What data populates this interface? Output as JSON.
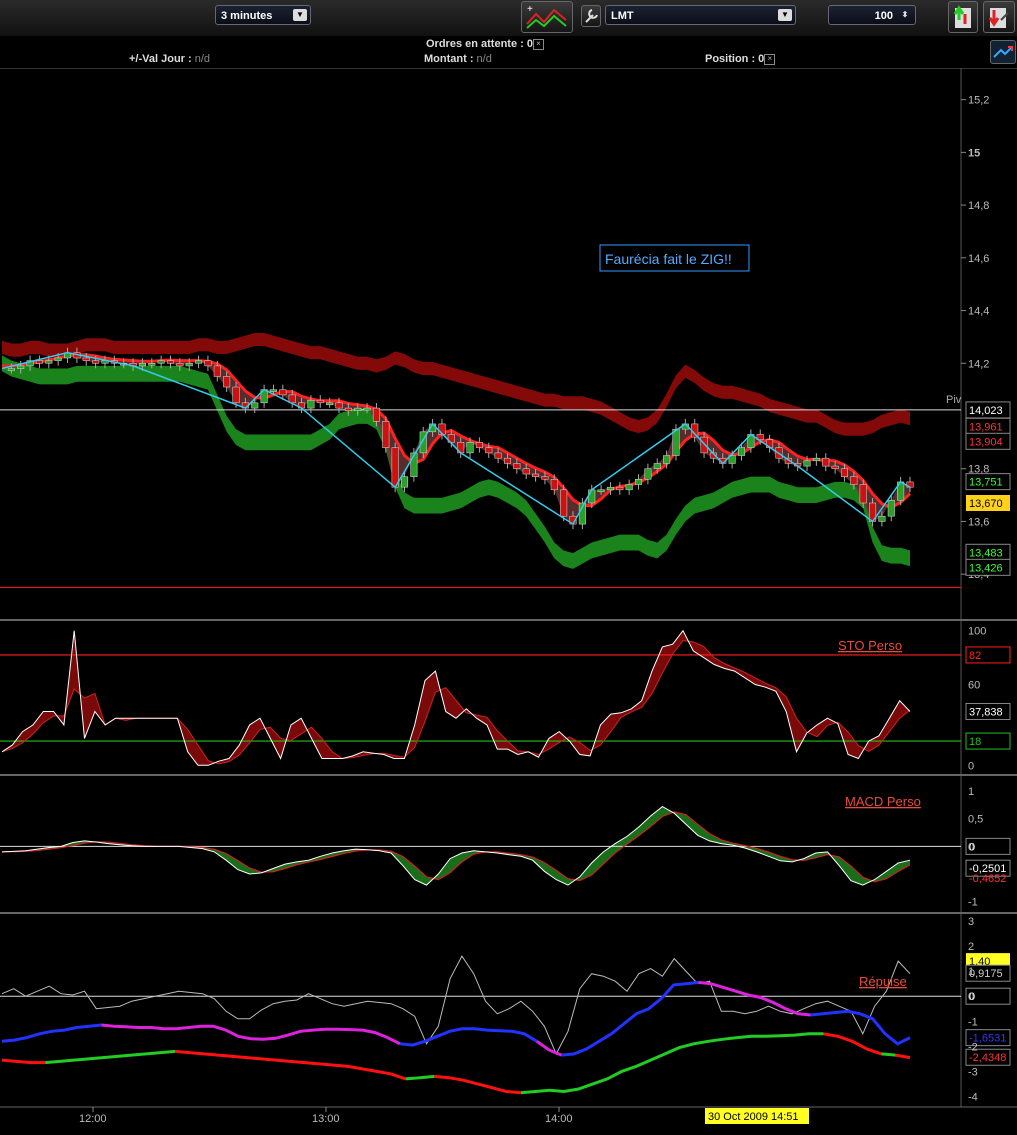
{
  "toolbar": {
    "timeframe": "3 minutes",
    "order_type": "LMT",
    "quantity": "100"
  },
  "info": {
    "ordres_label": "Ordres en attente :",
    "ordres_value": "0",
    "val_jour_label": "+/-Val Jour :",
    "val_jour_value": "n/d",
    "montant_label": "Montant :",
    "montant_value": "n/d",
    "position_label": "Position :",
    "position_value": "0"
  },
  "colors": {
    "bull": "#2aa02a",
    "bear": "#cc1111",
    "zigzag": "#33ccee",
    "upper_band": "#8b0a0a",
    "lower_band": "#1c8a1c",
    "ma": "#ff2020"
  },
  "chart_data": [
    {
      "type": "candlestick",
      "annotation": "Faurécia fait le ZIG!!",
      "pivot_label": "Piv",
      "ylim": [
        13.34,
        15.32
      ],
      "y_ticks": [
        "15,2",
        "15",
        "14,8",
        "14,6",
        "14,4",
        "14,2",
        "13,8",
        "13,6",
        "13,4"
      ],
      "x_ticks": [
        "12:00",
        "13:00",
        "14:00"
      ],
      "cursor_label": "30 Oct 2009 14:51",
      "price_labels": [
        {
          "text": "14,023",
          "value": 14.023,
          "color": "#ffffff"
        },
        {
          "text": "13,961",
          "value": 13.961,
          "color": "#ff3333"
        },
        {
          "text": "13,904",
          "value": 13.904,
          "color": "#ff3333"
        },
        {
          "text": "13,751",
          "value": 13.751,
          "color": "#33ff33"
        },
        {
          "text": "13,670",
          "value": 13.67,
          "color": "#000000",
          "bg": "#ffd21a"
        },
        {
          "text": "13,483",
          "value": 13.483,
          "color": "#33ff33"
        },
        {
          "text": "13,426",
          "value": 13.426,
          "color": "#33ff33"
        }
      ],
      "pivot_level": 14.023,
      "support_level": 13.35,
      "close": [
        14.18,
        14.18,
        14.19,
        14.21,
        14.2,
        14.21,
        14.22,
        14.24,
        14.22,
        14.21,
        14.2,
        14.21,
        14.2,
        14.2,
        14.19,
        14.2,
        14.2,
        14.21,
        14.2,
        14.19,
        14.2,
        14.21,
        14.19,
        14.15,
        14.11,
        14.05,
        14.03,
        14.05,
        14.1,
        14.1,
        14.08,
        14.05,
        14.03,
        14.06,
        14.05,
        14.05,
        14.03,
        14.02,
        14.03,
        14.03,
        13.98,
        13.88,
        13.73,
        13.77,
        13.86,
        13.94,
        13.97,
        13.93,
        13.9,
        13.86,
        13.9,
        13.88,
        13.86,
        13.84,
        13.82,
        13.8,
        13.78,
        13.77,
        13.76,
        13.72,
        13.62,
        13.59,
        13.67,
        13.72,
        13.72,
        13.73,
        13.72,
        13.74,
        13.76,
        13.8,
        13.82,
        13.85,
        13.95,
        13.97,
        13.92,
        13.86,
        13.84,
        13.82,
        13.85,
        13.88,
        13.93,
        13.91,
        13.88,
        13.84,
        13.82,
        13.81,
        13.83,
        13.84,
        13.81,
        13.8,
        13.77,
        13.74,
        13.67,
        13.6,
        13.62,
        13.68,
        13.75,
        13.73
      ],
      "upper_band": [
        14.26,
        14.25,
        14.25,
        14.26,
        14.26,
        14.25,
        14.25,
        14.25,
        14.26,
        14.27,
        14.27,
        14.27,
        14.26,
        14.26,
        14.26,
        14.26,
        14.26,
        14.26,
        14.26,
        14.26,
        14.26,
        14.27,
        14.27,
        14.26,
        14.26,
        14.27,
        14.28,
        14.29,
        14.29,
        14.28,
        14.27,
        14.26,
        14.25,
        14.24,
        14.24,
        14.23,
        14.22,
        14.21,
        14.2,
        14.2,
        14.19,
        14.2,
        14.22,
        14.21,
        14.19,
        14.18,
        14.18,
        14.17,
        14.16,
        14.15,
        14.14,
        14.13,
        14.12,
        14.11,
        14.1,
        14.09,
        14.08,
        14.07,
        14.06,
        14.06,
        14.05,
        14.05,
        14.05,
        14.04,
        14.03,
        14.01,
        13.99,
        13.97,
        13.96,
        13.97,
        14.0,
        14.06,
        14.13,
        14.17,
        14.15,
        14.12,
        14.1,
        14.09,
        14.09,
        14.08,
        14.07,
        14.06,
        14.04,
        14.03,
        14.02,
        14.01,
        14.0,
        14.0,
        13.98,
        13.96,
        13.95,
        13.95,
        13.95,
        13.96,
        13.98,
        13.99,
        14.0,
        13.99
      ],
      "lower_band": [
        14.2,
        14.18,
        14.17,
        14.16,
        14.15,
        14.15,
        14.15,
        14.15,
        14.16,
        14.16,
        14.16,
        14.16,
        14.16,
        14.16,
        14.16,
        14.16,
        14.16,
        14.16,
        14.16,
        14.16,
        14.15,
        14.14,
        14.13,
        14.05,
        13.97,
        13.92,
        13.9,
        13.9,
        13.9,
        13.9,
        13.9,
        13.9,
        13.9,
        13.9,
        13.92,
        13.94,
        13.98,
        13.99,
        14.0,
        14.0,
        13.98,
        13.9,
        13.76,
        13.68,
        13.66,
        13.66,
        13.66,
        13.66,
        13.67,
        13.68,
        13.7,
        13.72,
        13.73,
        13.72,
        13.7,
        13.68,
        13.65,
        13.6,
        13.55,
        13.49,
        13.46,
        13.45,
        13.47,
        13.49,
        13.5,
        13.51,
        13.52,
        13.52,
        13.52,
        13.5,
        13.49,
        13.52,
        13.58,
        13.63,
        13.66,
        13.67,
        13.68,
        13.7,
        13.72,
        13.73,
        13.74,
        13.74,
        13.74,
        13.72,
        13.71,
        13.7,
        13.7,
        13.7,
        13.71,
        13.72,
        13.72,
        13.71,
        13.68,
        13.55,
        13.48,
        13.47,
        13.47,
        13.46
      ]
    },
    {
      "type": "line",
      "title": "STO Perso",
      "ylim": [
        -5,
        105
      ],
      "y_ticks": [
        "100",
        "60",
        "0"
      ],
      "levels": [
        {
          "text": "82",
          "value": 82,
          "color": "#ff2020"
        },
        {
          "text": "18",
          "value": 18,
          "color": "#20c020"
        }
      ],
      "last_label": "37,838",
      "values": [
        10,
        15,
        25,
        30,
        40,
        40,
        30,
        100,
        20,
        40,
        30,
        35,
        35,
        35,
        35,
        35,
        35,
        35,
        10,
        0,
        0,
        3,
        5,
        15,
        30,
        35,
        20,
        5,
        30,
        35,
        20,
        5,
        5,
        5,
        7,
        10,
        9,
        8,
        5,
        5,
        30,
        63,
        70,
        40,
        35,
        42,
        35,
        30,
        12,
        12,
        8,
        10,
        6,
        20,
        25,
        18,
        8,
        7,
        30,
        38,
        39,
        42,
        48,
        70,
        88,
        90,
        100,
        85,
        80,
        75,
        72,
        70,
        65,
        60,
        58,
        55,
        40,
        10,
        24,
        30,
        35,
        31,
        8,
        5,
        18,
        22,
        35,
        48,
        40
      ]
    },
    {
      "type": "line",
      "title": "MACD Perso",
      "ylim": [
        -1.15,
        1.2
      ],
      "y_ticks": [
        "1",
        "0,5",
        "0",
        "-1"
      ],
      "zero_label": "0",
      "last_label": "-0,2501",
      "last_label_2": "-0,4652",
      "values": [
        -0.1,
        -0.09,
        -0.08,
        -0.05,
        -0.02,
        0.0,
        0.07,
        0.1,
        0.08,
        0.05,
        0.03,
        0.01,
        0.0,
        0.0,
        0.0,
        0.0,
        -0.02,
        -0.04,
        -0.1,
        -0.25,
        -0.42,
        -0.5,
        -0.48,
        -0.4,
        -0.32,
        -0.28,
        -0.25,
        -0.18,
        -0.12,
        -0.08,
        -0.05,
        -0.06,
        -0.08,
        -0.12,
        -0.35,
        -0.6,
        -0.7,
        -0.5,
        -0.22,
        -0.12,
        -0.08,
        -0.1,
        -0.12,
        -0.15,
        -0.18,
        -0.25,
        -0.45,
        -0.6,
        -0.7,
        -0.55,
        -0.3,
        -0.1,
        0.05,
        0.18,
        0.35,
        0.55,
        0.72,
        0.6,
        0.4,
        0.2,
        0.1,
        0.05,
        0.02,
        -0.03,
        -0.1,
        -0.18,
        -0.26,
        -0.28,
        -0.22,
        -0.12,
        -0.1,
        -0.35,
        -0.62,
        -0.7,
        -0.6,
        -0.45,
        -0.3,
        -0.25
      ]
    },
    {
      "type": "line",
      "title": "Répulse",
      "ylim": [
        -4.3,
        3.2
      ],
      "y_ticks": [
        "3",
        "2",
        "1",
        "0",
        "-1",
        "-2",
        "-3",
        "-4"
      ],
      "labels": [
        {
          "text": "1,40",
          "value": 1.4,
          "color": "#000000",
          "bg": "#ffff22"
        },
        {
          "text": "0,9175",
          "value": 0.9175,
          "color": "#cccccc"
        },
        {
          "text": "0",
          "value": 0,
          "color": "#ffffff"
        },
        {
          "text": "-1,6531",
          "value": -1.6531,
          "color": "#3333ff"
        },
        {
          "text": "-2,4348",
          "value": -2.4348,
          "color": "#ff3333"
        }
      ],
      "series": [
        {
          "values": [
            0.1,
            0.3,
            0.0,
            0.2,
            0.4,
            0.1,
            0.05,
            0.2,
            -0.5,
            -0.45,
            -0.4,
            -0.2,
            -0.1,
            0.0,
            0.1,
            0.2,
            0.15,
            0.1,
            -0.1,
            -0.6,
            -0.9,
            -0.9,
            -0.55,
            -0.3,
            -0.2,
            -0.15,
            0.1,
            -0.1,
            -0.3,
            -0.4,
            -0.3,
            -0.2,
            -0.25,
            -0.3,
            -0.5,
            -0.8,
            -1.9,
            -1.2,
            0.7,
            1.6,
            0.9,
            -0.2,
            -0.7,
            -0.5,
            -0.2,
            -0.6,
            -1.2,
            -2.3,
            -1.4,
            0.3,
            0.9,
            0.8,
            0.6,
            0.2,
            0.9,
            1.1,
            0.8,
            1.5,
            1.0,
            0.5,
            0.6,
            -0.6,
            -0.6,
            -0.7,
            -0.6,
            -0.4,
            -0.6,
            -0.7,
            -0.5,
            -0.3,
            -0.2,
            -0.4,
            -0.6,
            -1.5,
            -0.4,
            0.2,
            1.4,
            0.9
          ]
        },
        {
          "segments": [
            {
              "color": "#2233ff",
              "values": [
                -1.8,
                -1.75,
                -1.65,
                -1.5,
                -1.4,
                -1.35,
                -1.25,
                -1.2,
                -1.15
              ]
            },
            {
              "color": "#dd22dd",
              "values": [
                -1.15,
                -1.2,
                -1.22,
                -1.25,
                -1.25,
                -1.3,
                -1.3,
                -1.25,
                -1.2,
                -1.2,
                -1.35,
                -1.6,
                -1.7,
                -1.72,
                -1.68,
                -1.55,
                -1.4,
                -1.35,
                -1.32,
                -1.32,
                -1.33,
                -1.35,
                -1.45,
                -1.65,
                -1.9
              ]
            },
            {
              "color": "#2233ff",
              "values": [
                -1.9,
                -1.95,
                -1.8,
                -1.6,
                -1.4,
                -1.3,
                -1.3,
                -1.35,
                -1.38,
                -1.4,
                -1.5,
                -1.8
              ]
            },
            {
              "color": "#dd22dd",
              "values": [
                -1.8,
                -2.15,
                -2.35
              ]
            },
            {
              "color": "#2233ff",
              "values": [
                -2.35,
                -2.3,
                -2.1,
                -1.8,
                -1.5,
                -1.1,
                -0.7,
                -0.5,
                -0.1,
                0.45,
                0.5,
                0.55
              ]
            },
            {
              "color": "#dd22dd",
              "values": [
                0.55,
                0.5,
                0.35,
                0.2,
                0.05,
                -0.05,
                -0.25,
                -0.5,
                -0.7,
                -0.75
              ]
            },
            {
              "color": "#2233ff",
              "values": [
                -0.75,
                -0.7,
                -0.65,
                -0.6,
                -0.7,
                -0.9,
                -1.5,
                -1.9,
                -1.65
              ]
            }
          ]
        },
        {
          "segments": [
            {
              "color": "#ff1010",
              "values": [
                -2.55,
                -2.6,
                -2.65,
                -2.65
              ]
            },
            {
              "color": "#22cc22",
              "values": [
                -2.65,
                -2.6,
                -2.55,
                -2.5,
                -2.45,
                -2.4,
                -2.35,
                -2.3,
                -2.25,
                -2.2
              ]
            },
            {
              "color": "#ff1010",
              "values": [
                -2.2,
                -2.25,
                -2.3,
                -2.35,
                -2.4,
                -2.45,
                -2.5,
                -2.55,
                -2.6,
                -2.65,
                -2.7,
                -2.75,
                -2.8,
                -2.9,
                -3.0,
                -3.1,
                -3.3
              ]
            },
            {
              "color": "#22cc22",
              "values": [
                -3.3,
                -3.25,
                -3.2
              ]
            },
            {
              "color": "#ff1010",
              "values": [
                -3.2,
                -3.25,
                -3.35,
                -3.5,
                -3.65,
                -3.8,
                -3.85
              ]
            },
            {
              "color": "#22cc22",
              "values": [
                -3.85,
                -3.8,
                -3.75,
                -3.8,
                -3.7,
                -3.5,
                -3.3,
                -3.0,
                -2.8,
                -2.55,
                -2.3,
                -2.05,
                -1.9,
                -1.8,
                -1.72,
                -1.65,
                -1.6,
                -1.6,
                -1.58,
                -1.55,
                -1.5,
                -1.5
              ]
            },
            {
              "color": "#ff1010",
              "values": [
                -1.5,
                -1.6,
                -1.8,
                -2.1,
                -2.3
              ]
            },
            {
              "color": "#22cc22",
              "values": [
                -2.3,
                -2.35
              ]
            },
            {
              "color": "#ff1010",
              "values": [
                -2.35,
                -2.45
              ]
            }
          ]
        }
      ]
    }
  ]
}
